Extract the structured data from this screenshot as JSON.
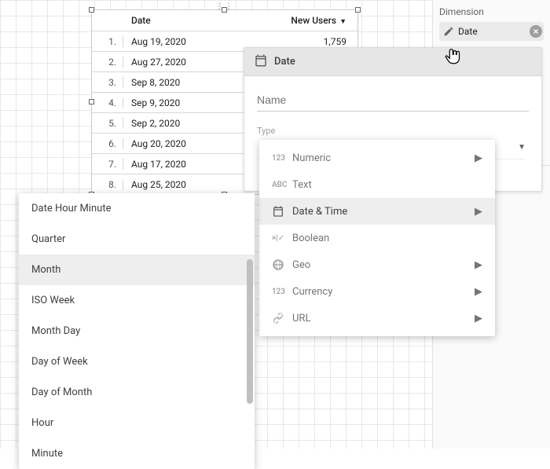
{
  "rightPanel": {
    "dimensionLabel": "Dimension",
    "chipLabel": "Date"
  },
  "table": {
    "header": {
      "col1": "Date",
      "col2": "New Users"
    },
    "rows": [
      {
        "idx": "1.",
        "date": "Aug 19, 2020",
        "val": "1,759"
      },
      {
        "idx": "2.",
        "date": "Aug 27, 2020",
        "val": ""
      },
      {
        "idx": "3.",
        "date": "Sep 8, 2020",
        "val": ""
      },
      {
        "idx": "4.",
        "date": "Sep 9, 2020",
        "val": ""
      },
      {
        "idx": "5.",
        "date": "Sep 2, 2020",
        "val": ""
      },
      {
        "idx": "6.",
        "date": "Aug 20, 2020",
        "val": ""
      },
      {
        "idx": "7.",
        "date": "Aug 17, 2020",
        "val": ""
      },
      {
        "idx": "8.",
        "date": "Aug 25, 2020",
        "val": ""
      }
    ]
  },
  "granularity": {
    "items": [
      {
        "label": "Date Hour Minute",
        "selected": false
      },
      {
        "label": "Quarter",
        "selected": false
      },
      {
        "label": "Month",
        "selected": true
      },
      {
        "label": "ISO Week",
        "selected": false
      },
      {
        "label": "Month Day",
        "selected": false
      },
      {
        "label": "Day of Week",
        "selected": false
      },
      {
        "label": "Day of Month",
        "selected": false
      },
      {
        "label": "Hour",
        "selected": false
      },
      {
        "label": "Minute",
        "selected": false
      }
    ]
  },
  "fieldEditor": {
    "title": "Date",
    "namePlaceholder": "Name",
    "typeLabel": "Type"
  },
  "typeMenu": {
    "items": [
      {
        "icon": "numeric",
        "iconText": "123",
        "label": "Numeric",
        "hasSub": true,
        "selected": false
      },
      {
        "icon": "text",
        "iconText": "ABC",
        "label": "Text",
        "hasSub": false,
        "selected": false
      },
      {
        "icon": "calendar",
        "iconText": "",
        "label": "Date & Time",
        "hasSub": true,
        "selected": true
      },
      {
        "icon": "boolean",
        "iconText": "×|✓",
        "label": "Boolean",
        "hasSub": false,
        "selected": false
      },
      {
        "icon": "geo",
        "iconText": "",
        "label": "Geo",
        "hasSub": true,
        "selected": false
      },
      {
        "icon": "currency",
        "iconText": "123",
        "label": "Currency",
        "hasSub": true,
        "selected": false
      },
      {
        "icon": "url",
        "iconText": "",
        "label": "URL",
        "hasSub": true,
        "selected": false
      }
    ]
  }
}
